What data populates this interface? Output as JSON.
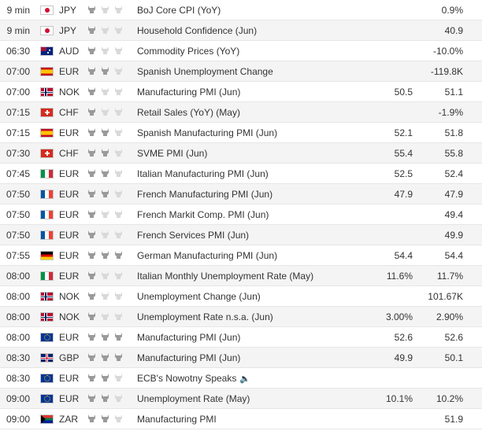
{
  "colors": {
    "row_alt": "#f4f4f4",
    "divider": "#e6e6e6",
    "bull_active": "#9a9a9a",
    "bull_inactive": "#d9d9d9"
  },
  "calendar": {
    "rows": [
      {
        "time": "9 min",
        "flag": "japan-flag",
        "currency": "JPY",
        "importance": 1,
        "event": "BoJ Core CPI (YoY)",
        "forecast": "",
        "previous": "0.9%"
      },
      {
        "time": "9 min",
        "flag": "japan-flag",
        "currency": "JPY",
        "importance": 1,
        "event": "Household Confidence (Jun)",
        "forecast": "",
        "previous": "40.9"
      },
      {
        "time": "06:30",
        "flag": "australia-flag",
        "currency": "AUD",
        "importance": 1,
        "event": "Commodity Prices (YoY)",
        "forecast": "",
        "previous": "-10.0%"
      },
      {
        "time": "07:00",
        "flag": "spain-flag",
        "currency": "EUR",
        "importance": 2,
        "event": "Spanish Unemployment Change",
        "forecast": "",
        "previous": "-119.8K"
      },
      {
        "time": "07:00",
        "flag": "norway-flag",
        "currency": "NOK",
        "importance": 1,
        "event": "Manufacturing PMI (Jun)",
        "forecast": "50.5",
        "previous": "51.1"
      },
      {
        "time": "07:15",
        "flag": "switzerland-flag",
        "currency": "CHF",
        "importance": 1,
        "event": "Retail Sales (YoY) (May)",
        "forecast": "",
        "previous": "-1.9%"
      },
      {
        "time": "07:15",
        "flag": "spain-flag",
        "currency": "EUR",
        "importance": 2,
        "event": "Spanish Manufacturing PMI (Jun)",
        "forecast": "52.1",
        "previous": "51.8"
      },
      {
        "time": "07:30",
        "flag": "switzerland-flag",
        "currency": "CHF",
        "importance": 2,
        "event": "SVME PMI (Jun)",
        "forecast": "55.4",
        "previous": "55.8"
      },
      {
        "time": "07:45",
        "flag": "italy-flag",
        "currency": "EUR",
        "importance": 2,
        "event": "Italian Manufacturing PMI (Jun)",
        "forecast": "52.5",
        "previous": "52.4"
      },
      {
        "time": "07:50",
        "flag": "france-flag",
        "currency": "EUR",
        "importance": 2,
        "event": "French Manufacturing PMI (Jun)",
        "forecast": "47.9",
        "previous": "47.9"
      },
      {
        "time": "07:50",
        "flag": "france-flag",
        "currency": "EUR",
        "importance": 1,
        "event": "French Markit Comp. PMI (Jun)",
        "forecast": "",
        "previous": "49.4"
      },
      {
        "time": "07:50",
        "flag": "france-flag",
        "currency": "EUR",
        "importance": 1,
        "event": "French Services PMI (Jun)",
        "forecast": "",
        "previous": "49.9"
      },
      {
        "time": "07:55",
        "flag": "germany-flag",
        "currency": "EUR",
        "importance": 3,
        "event": "German Manufacturing PMI (Jun)",
        "forecast": "54.4",
        "previous": "54.4"
      },
      {
        "time": "08:00",
        "flag": "italy-flag",
        "currency": "EUR",
        "importance": 1,
        "event": "Italian Monthly Unemployment Rate (May)",
        "forecast": "11.6%",
        "previous": "11.7%"
      },
      {
        "time": "08:00",
        "flag": "norway-flag",
        "currency": "NOK",
        "importance": 1,
        "event": "Unemployment Change (Jun)",
        "forecast": "",
        "previous": "101.67K"
      },
      {
        "time": "08:00",
        "flag": "norway-flag",
        "currency": "NOK",
        "importance": 1,
        "event": "Unemployment Rate n.s.a. (Jun)",
        "forecast": "3.00%",
        "previous": "2.90%"
      },
      {
        "time": "08:00",
        "flag": "eu-flag",
        "currency": "EUR",
        "importance": 3,
        "event": "Manufacturing PMI (Jun)",
        "forecast": "52.6",
        "previous": "52.6"
      },
      {
        "time": "08:30",
        "flag": "uk-flag",
        "currency": "GBP",
        "importance": 3,
        "event": "Manufacturing PMI (Jun)",
        "forecast": "49.9",
        "previous": "50.1"
      },
      {
        "time": "08:30",
        "flag": "eu-flag",
        "currency": "EUR",
        "importance": 2,
        "event": "ECB's Nowotny Speaks",
        "speaker": true,
        "forecast": "",
        "previous": ""
      },
      {
        "time": "09:00",
        "flag": "eu-flag",
        "currency": "EUR",
        "importance": 2,
        "event": "Unemployment Rate (May)",
        "forecast": "10.1%",
        "previous": "10.2%"
      },
      {
        "time": "09:00",
        "flag": "south-africa-flag",
        "currency": "ZAR",
        "importance": 2,
        "event": "Manufacturing PMI",
        "forecast": "",
        "previous": "51.9"
      }
    ]
  }
}
